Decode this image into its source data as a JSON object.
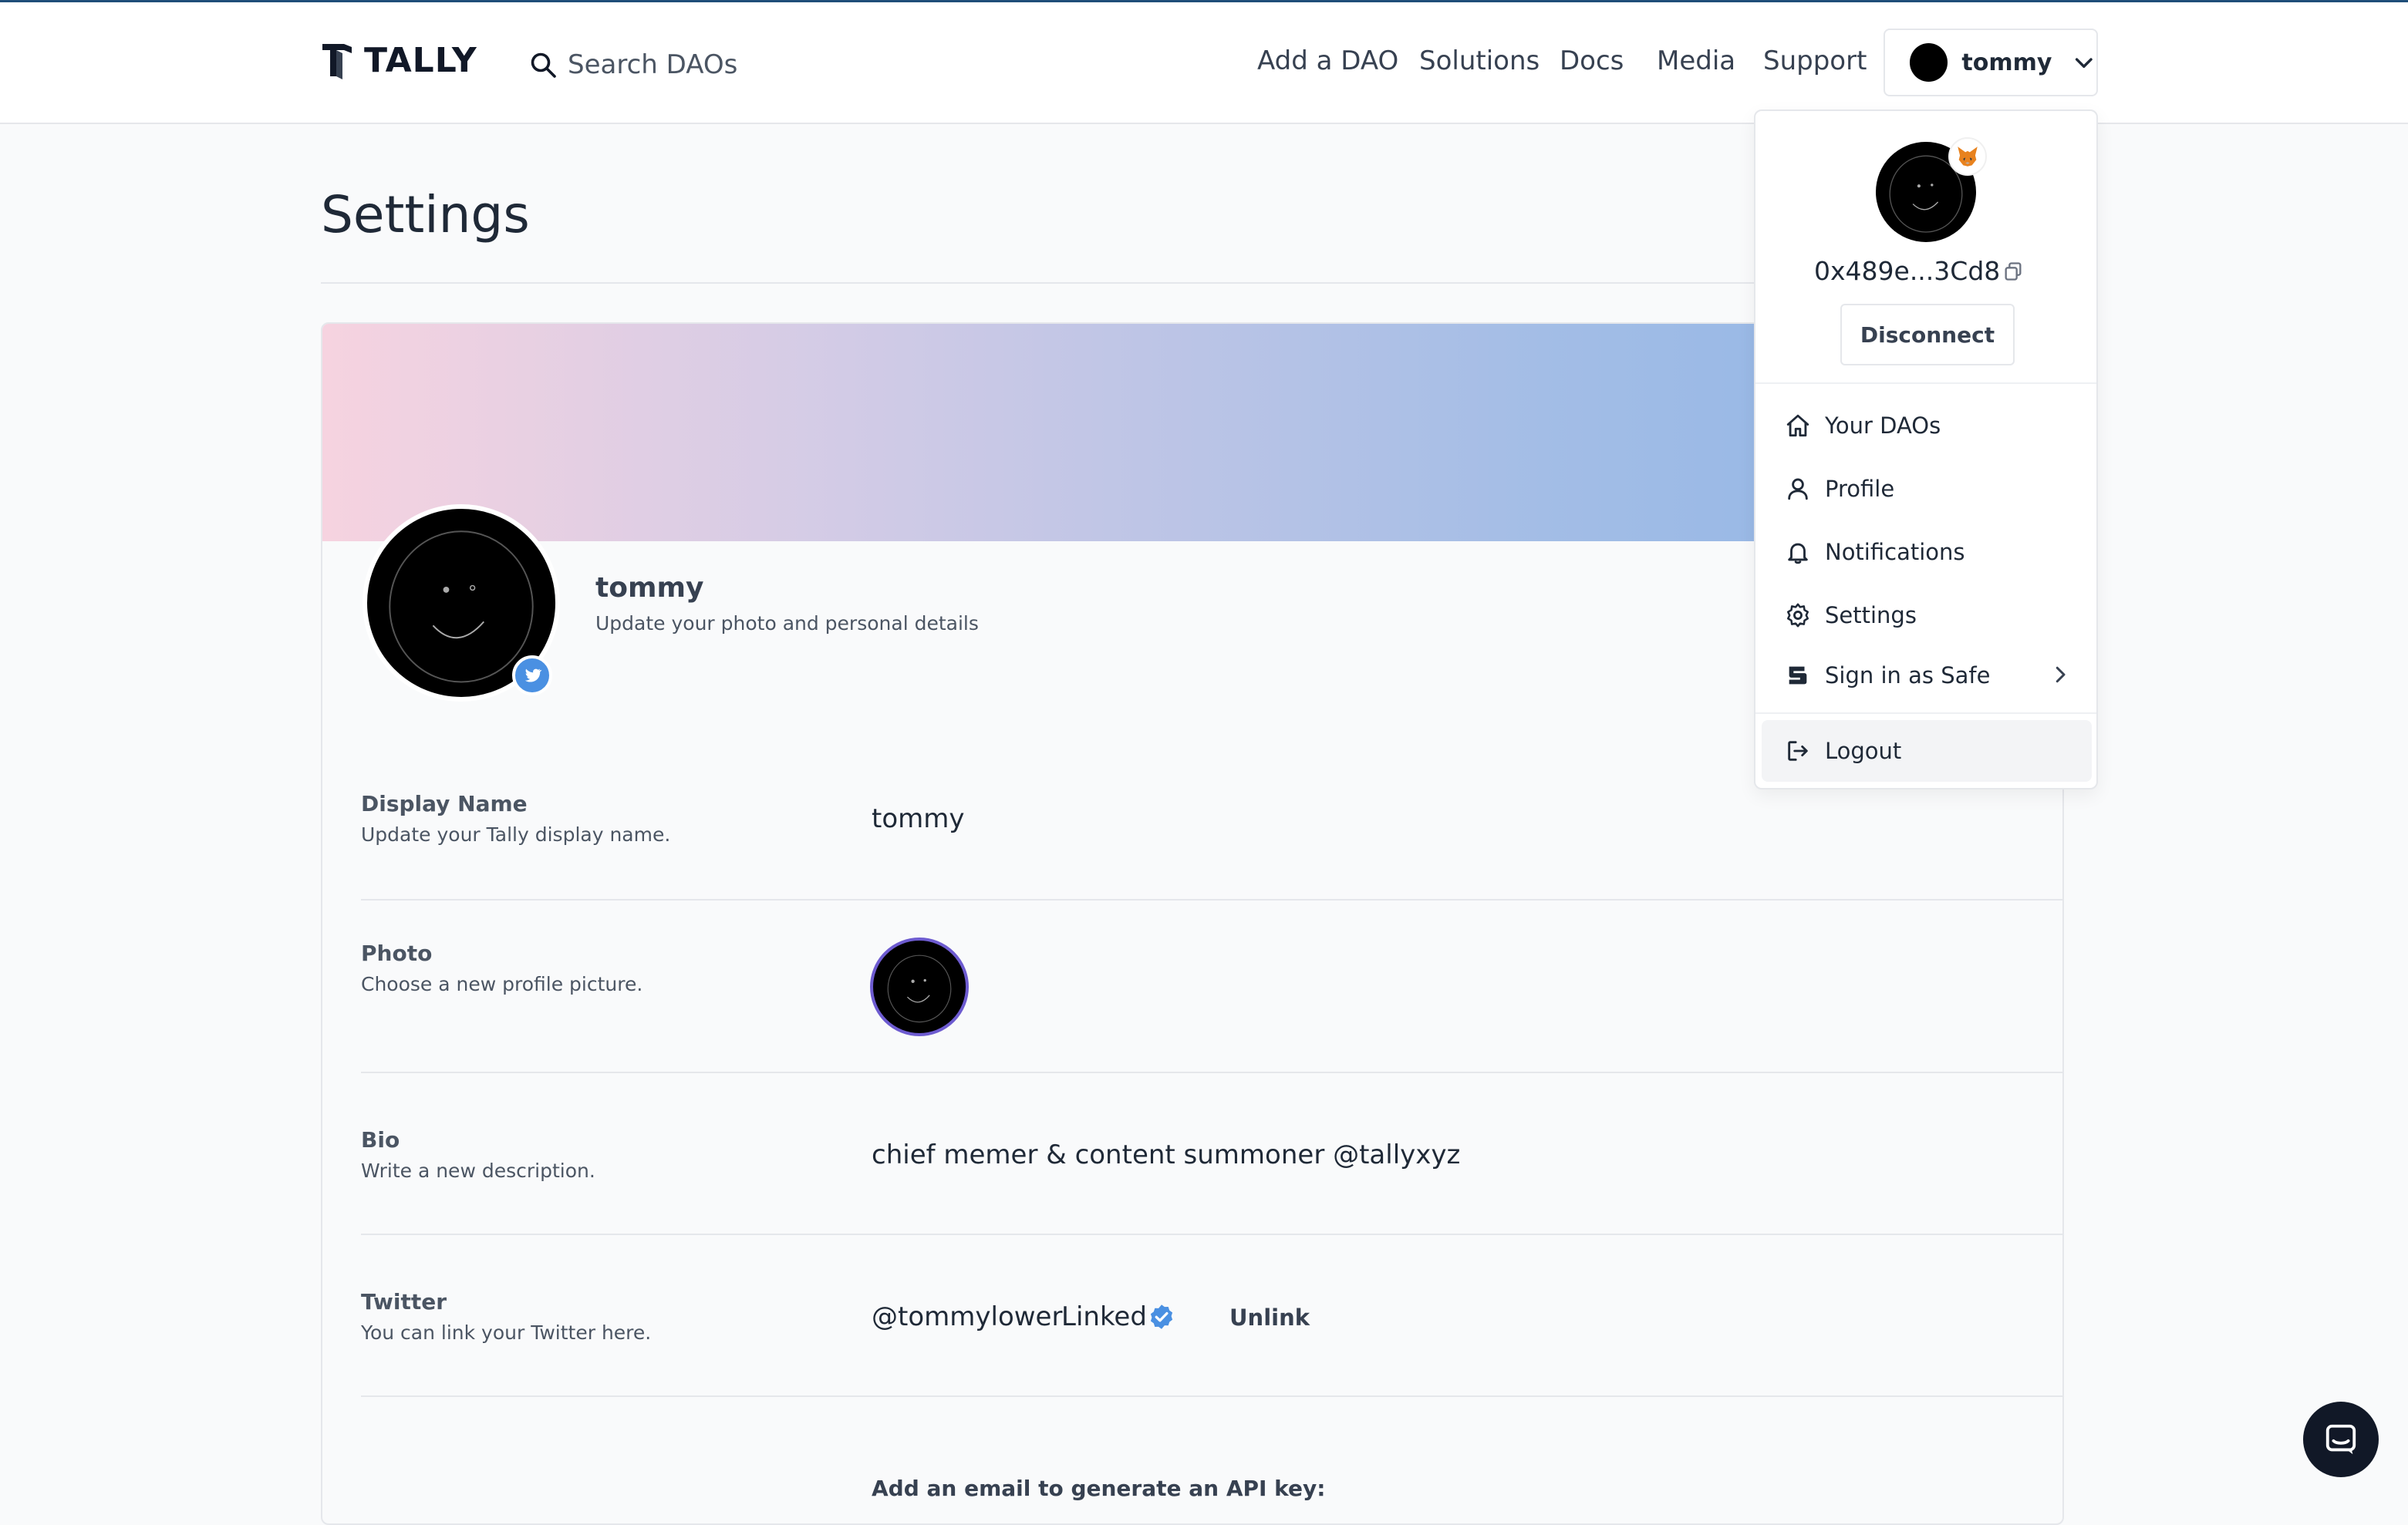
{
  "brand": {
    "name": "TALLY"
  },
  "header": {
    "search_placeholder": "Search DAOs",
    "nav": [
      "Add a DAO",
      "Solutions",
      "Docs",
      "Media",
      "Support"
    ],
    "user_label": "tommy"
  },
  "page": {
    "title": "Settings"
  },
  "profile": {
    "name": "tommy",
    "subtitle": "Update your photo and personal details"
  },
  "settings": {
    "display_name": {
      "label": "Display Name",
      "desc": "Update your Tally display name.",
      "value": "tommy"
    },
    "photo": {
      "label": "Photo",
      "desc": "Choose a new profile picture."
    },
    "bio": {
      "label": "Bio",
      "desc": "Write a new description.",
      "value": "chief memer & content summoner @tallyxyz"
    },
    "twitter": {
      "label": "Twitter",
      "desc": "You can link your Twitter here.",
      "handle": "@tommylower",
      "status": "Linked",
      "action": "Unlink"
    },
    "api_key_prompt": "Add an email to generate an API key:"
  },
  "dropdown": {
    "address": "0x489e...3Cd8",
    "disconnect": "Disconnect",
    "items": [
      "Your DAOs",
      "Profile",
      "Notifications",
      "Settings",
      "Sign in as Safe"
    ],
    "logout": "Logout"
  },
  "colors": {
    "accent": "#4a90e2",
    "photo_border": "#6d5bd0"
  }
}
